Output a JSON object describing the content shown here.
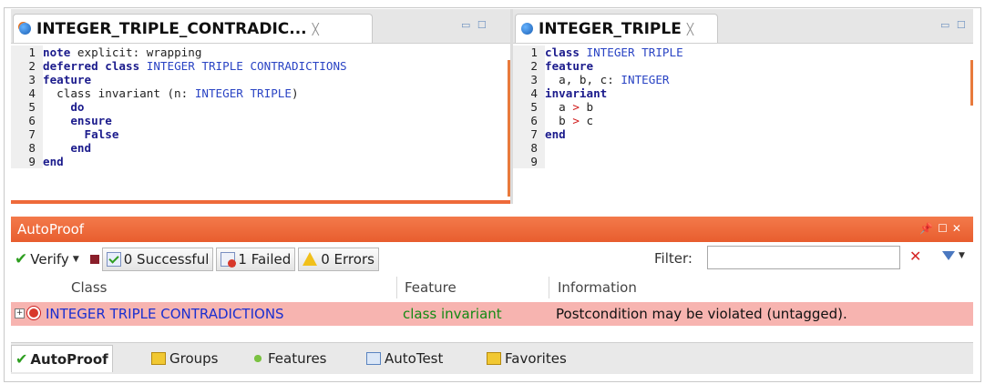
{
  "left_editor": {
    "tab_title": "INTEGER_TRIPLE_CONTRADIC...",
    "close_glyph": "╳",
    "lines": [
      {
        "n": "1",
        "tokens": [
          {
            "t": "note",
            "k": "kw"
          },
          {
            "t": " explicit: wrapping",
            "k": "plain"
          }
        ]
      },
      {
        "n": "2",
        "tokens": [
          {
            "t": "deferred class",
            "k": "kw"
          },
          {
            "t": " INTEGER TRIPLE CONTRADICTIONS",
            "k": "type"
          }
        ]
      },
      {
        "n": "3",
        "tokens": [
          {
            "t": "feature",
            "k": "kw"
          }
        ]
      },
      {
        "n": "4",
        "tokens": [
          {
            "t": "  class invariant (n: ",
            "k": "plain"
          },
          {
            "t": "INTEGER TRIPLE",
            "k": "type"
          },
          {
            "t": ")",
            "k": "plain"
          }
        ]
      },
      {
        "n": "5",
        "tokens": [
          {
            "t": "    ",
            "k": "plain"
          },
          {
            "t": "do",
            "k": "kw"
          }
        ]
      },
      {
        "n": "6",
        "tokens": [
          {
            "t": "    ",
            "k": "plain"
          },
          {
            "t": "ensure",
            "k": "kw"
          }
        ]
      },
      {
        "n": "7",
        "tokens": [
          {
            "t": "      ",
            "k": "plain"
          },
          {
            "t": "False",
            "k": "kw"
          }
        ]
      },
      {
        "n": "8",
        "tokens": [
          {
            "t": "    ",
            "k": "plain"
          },
          {
            "t": "end",
            "k": "kw"
          }
        ]
      },
      {
        "n": "9",
        "tokens": [
          {
            "t": "end",
            "k": "kw"
          }
        ]
      }
    ]
  },
  "right_editor": {
    "tab_title": "INTEGER_TRIPLE",
    "close_glyph": "╳",
    "lines": [
      {
        "n": "1",
        "tokens": [
          {
            "t": "class",
            "k": "kw"
          },
          {
            "t": " INTEGER TRIPLE",
            "k": "type"
          }
        ]
      },
      {
        "n": "2",
        "tokens": [
          {
            "t": "feature",
            "k": "kw"
          }
        ]
      },
      {
        "n": "3",
        "tokens": [
          {
            "t": "  a, b, c: ",
            "k": "plain"
          },
          {
            "t": "INTEGER",
            "k": "type"
          }
        ]
      },
      {
        "n": "4",
        "tokens": [
          {
            "t": "invariant",
            "k": "kw"
          }
        ]
      },
      {
        "n": "5",
        "tokens": [
          {
            "t": "  a ",
            "k": "plain"
          },
          {
            "t": ">",
            "k": "op"
          },
          {
            "t": " b",
            "k": "plain"
          }
        ]
      },
      {
        "n": "6",
        "tokens": [
          {
            "t": "  b ",
            "k": "plain"
          },
          {
            "t": ">",
            "k": "op"
          },
          {
            "t": " c",
            "k": "plain"
          }
        ]
      },
      {
        "n": "7",
        "tokens": [
          {
            "t": "end",
            "k": "kw"
          }
        ]
      },
      {
        "n": "8",
        "tokens": []
      },
      {
        "n": "9",
        "tokens": []
      }
    ]
  },
  "autoproof": {
    "title": "AutoProof",
    "verify_label": "Verify",
    "successful_label": "0 Successful",
    "failed_label": "1 Failed",
    "errors_label": "0 Errors",
    "filter_label": "Filter:",
    "filter_value": "",
    "columns": {
      "class": "Class",
      "feature": "Feature",
      "information": "Information"
    },
    "rows": [
      {
        "class": "INTEGER TRIPLE CONTRADICTIONS",
        "feature": "class invariant",
        "information": "Postcondition may be violated (untagged)."
      }
    ]
  },
  "bottom_tabs": [
    {
      "label": "AutoProof",
      "icon": "check-icon",
      "active": true
    },
    {
      "label": "Groups",
      "icon": "groups-icon",
      "active": false
    },
    {
      "label": "Features",
      "icon": "features-icon",
      "active": false
    },
    {
      "label": "AutoTest",
      "icon": "autotest-icon",
      "active": false
    },
    {
      "label": "Favorites",
      "icon": "favorites-icon",
      "active": false
    }
  ],
  "colors": {
    "accent_orange": "#e85d2f",
    "failed_row": "#f7b4b0",
    "keyword": "#1b1b8c",
    "type": "#2a44c4",
    "success_green": "#2e9e20"
  }
}
